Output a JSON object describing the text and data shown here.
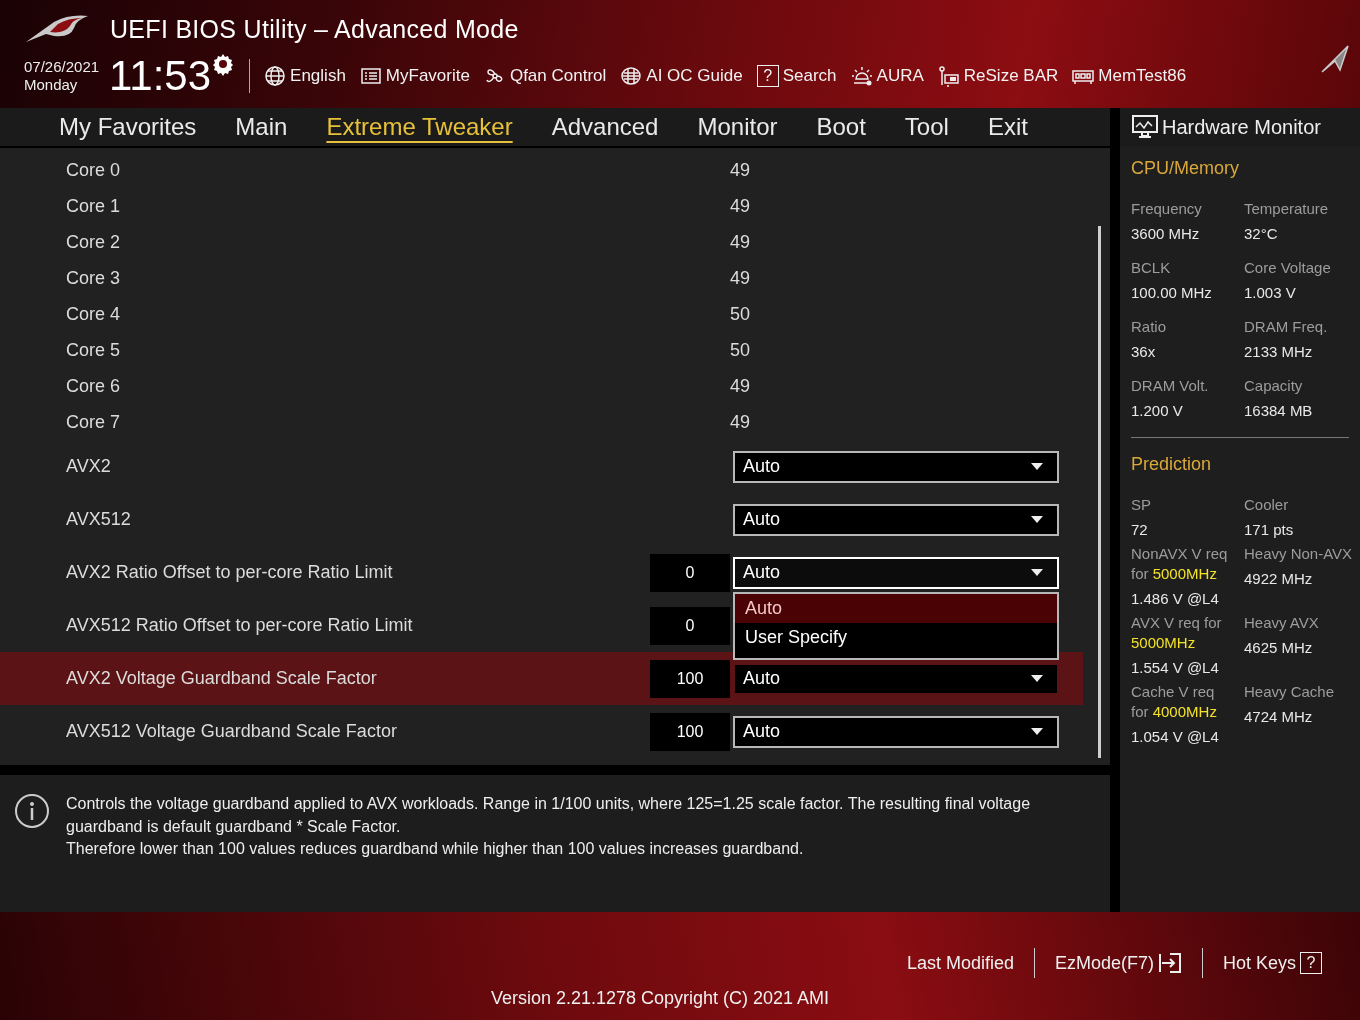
{
  "header": {
    "title": "UEFI BIOS Utility – Advanced Mode",
    "date": "07/26/2021",
    "day": "Monday",
    "time": "11:53",
    "toolbar": [
      {
        "label": "English"
      },
      {
        "label": "MyFavorite"
      },
      {
        "label": "Qfan Control"
      },
      {
        "label": "AI OC Guide"
      },
      {
        "label": "Search",
        "glyph": "?"
      },
      {
        "label": "AURA"
      },
      {
        "label": "ReSize BAR"
      },
      {
        "label": "MemTest86"
      }
    ]
  },
  "tabs": [
    {
      "label": "My Favorites",
      "selected": false
    },
    {
      "label": "Main",
      "selected": false
    },
    {
      "label": "Extreme Tweaker",
      "selected": true
    },
    {
      "label": "Advanced",
      "selected": false
    },
    {
      "label": "Monitor",
      "selected": false
    },
    {
      "label": "Boot",
      "selected": false
    },
    {
      "label": "Tool",
      "selected": false
    },
    {
      "label": "Exit",
      "selected": false
    }
  ],
  "settings": [
    {
      "kind": "value",
      "label": "Core 0",
      "value": "49",
      "selected": false
    },
    {
      "kind": "value",
      "label": "Core 1",
      "value": "49",
      "selected": false
    },
    {
      "kind": "value",
      "label": "Core 2",
      "value": "49",
      "selected": false
    },
    {
      "kind": "value",
      "label": "Core 3",
      "value": "49",
      "selected": false
    },
    {
      "kind": "value",
      "label": "Core 4",
      "value": "50",
      "selected": false
    },
    {
      "kind": "value",
      "label": "Core 5",
      "value": "50",
      "selected": false
    },
    {
      "kind": "value",
      "label": "Core 6",
      "value": "49",
      "selected": false
    },
    {
      "kind": "value",
      "label": "Core 7",
      "value": "49",
      "selected": false
    },
    {
      "kind": "dropdown",
      "label": "AVX2",
      "value": "Auto",
      "selected": false,
      "expanded": false
    },
    {
      "kind": "dropdown",
      "label": "AVX512",
      "value": "Auto",
      "selected": false,
      "expanded": false
    },
    {
      "kind": "number_dropdown",
      "label": "AVX2 Ratio Offset to per-core Ratio Limit",
      "number": "0",
      "value": "Auto",
      "selected": false,
      "expanded": true,
      "options": [
        {
          "label": "Auto",
          "selected": true
        },
        {
          "label": "User Specify",
          "selected": false
        }
      ]
    },
    {
      "kind": "number_dropdown",
      "label": "AVX512 Ratio Offset to per-core Ratio Limit",
      "number": "0",
      "selected": false
    },
    {
      "kind": "number_dropdown",
      "label": "AVX2 Voltage Guardband Scale Factor",
      "number": "100",
      "value": "Auto",
      "selected": true,
      "expanded": false
    },
    {
      "kind": "number_dropdown",
      "label": "AVX512 Voltage Guardband Scale Factor",
      "number": "100",
      "value": "Auto",
      "selected": false,
      "expanded": false
    }
  ],
  "help": {
    "paragraphs": [
      "Controls the voltage guardband applied to AVX workloads. Range in 1/100 units, where 125=1.25 scale factor. The resulting final voltage guardband is default guardband * Scale Factor.",
      "Therefore lower than 100 values reduces guardband while higher than 100 values increases guardband."
    ]
  },
  "hardware_monitor": {
    "title": "Hardware Monitor",
    "sections": [
      {
        "title": "CPU/Memory",
        "items": [
          {
            "label": "Frequency",
            "value": "3600 MHz"
          },
          {
            "label": "Temperature",
            "value": "32°C"
          },
          {
            "label": "BCLK",
            "value": "100.00 MHz"
          },
          {
            "label": "Core Voltage",
            "value": "1.003 V"
          },
          {
            "label": "Ratio",
            "value": "36x"
          },
          {
            "label": "DRAM Freq.",
            "value": "2133 MHz"
          },
          {
            "label": "DRAM Volt.",
            "value": "1.200 V"
          },
          {
            "label": "Capacity",
            "value": "16384 MB"
          }
        ]
      },
      {
        "title": "Prediction",
        "items": [
          {
            "label": "SP",
            "value": "72"
          },
          {
            "label": "Cooler",
            "value": "171 pts"
          },
          {
            "label": "NonAVX V req for **5000MHz**",
            "value": "1.486 V @L4"
          },
          {
            "label": "Heavy Non-AVX",
            "value": "4922 MHz"
          },
          {
            "label": "AVX V req for **5000MHz**",
            "value": "1.554 V @L4"
          },
          {
            "label": "Heavy AVX",
            "value": "4625 MHz"
          },
          {
            "label": "Cache V req for **4000MHz**",
            "value": "1.054 V @L4"
          },
          {
            "label": "Heavy Cache",
            "value": "4724 MHz"
          }
        ]
      }
    ]
  },
  "footer": {
    "actions": [
      {
        "label": "Last Modified"
      },
      {
        "label": "EzMode(F7)"
      },
      {
        "label": "Hot Keys",
        "glyph": "?"
      }
    ],
    "version": "Version 2.21.1278 Copyright (C) 2021 AMI"
  }
}
